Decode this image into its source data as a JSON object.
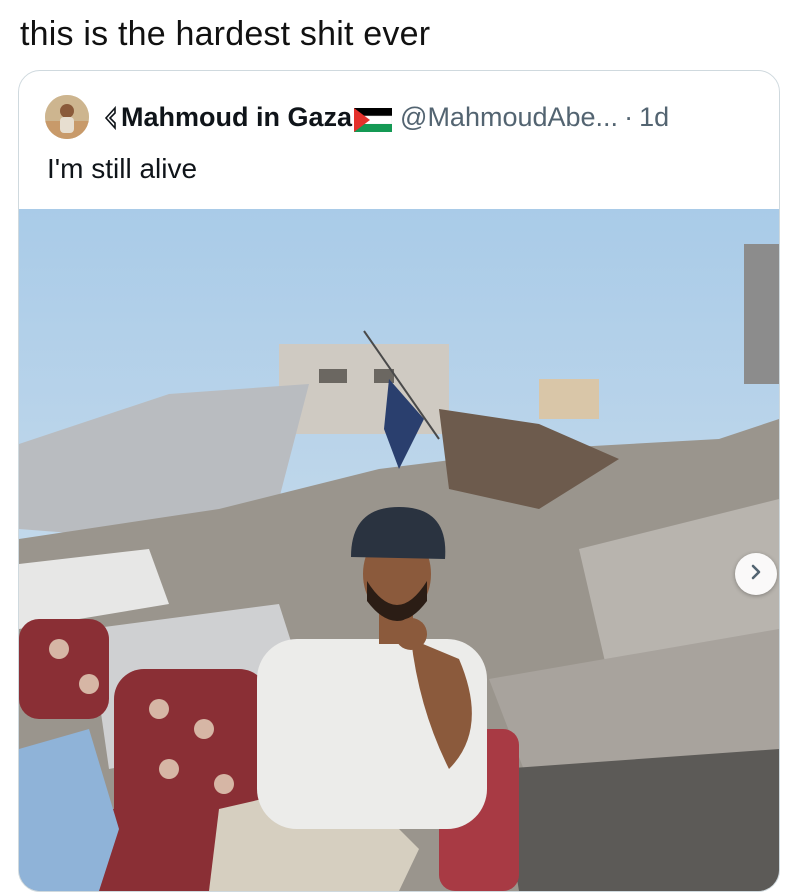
{
  "caption": "this is the hardest shit ever",
  "quote": {
    "author_name": "Mahmoud in Gaza",
    "handle": "@MahmoudAbe...",
    "separator": "·",
    "time": "1d",
    "text": "I'm still alive",
    "icons": {
      "name_prefix": "keyhole-icon",
      "name_suffix": "palestine-flag-icon"
    }
  },
  "media": {
    "carousel_next": "chevron-right-icon"
  },
  "colors": {
    "text": "#0f1419",
    "secondary_text": "#536471",
    "border": "#cfd9de",
    "flag_black": "#000000",
    "flag_white": "#ffffff",
    "flag_green": "#149954",
    "flag_red": "#e4312b"
  }
}
